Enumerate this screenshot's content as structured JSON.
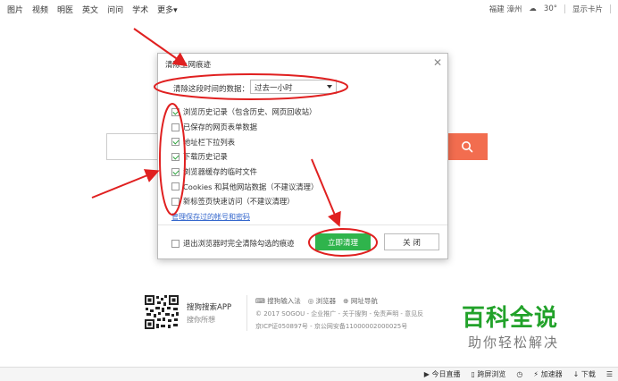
{
  "topnav": {
    "links": [
      "图片",
      "视频",
      "明医",
      "英文",
      "问问",
      "学术",
      "更多▾"
    ],
    "weather": "福建 漳州",
    "temperature": "30°",
    "show_card": "显示卡片"
  },
  "dialog": {
    "title": "清除上网痕迹",
    "time_label": "清除这段时间的数据：",
    "time_value": "过去一小时",
    "options": [
      {
        "label": "浏览历史记录（包含历史、网页回收站）",
        "checked": true
      },
      {
        "label": "已保存的网页表单数据",
        "checked": false
      },
      {
        "label": "地址栏下拉列表",
        "checked": true
      },
      {
        "label": "下载历史记录",
        "checked": true
      },
      {
        "label": "浏览器缓存的临时文件",
        "checked": true
      },
      {
        "label": "Cookies 和其他网站数据（不建议清理）",
        "checked": false
      },
      {
        "label": "新标签页快速访问（不建议清理）",
        "checked": false
      }
    ],
    "manage_link": "管理保存过的帐号和密码",
    "exit_clear_label": "退出浏览器时完全清除勾选的痕迹",
    "clear_button": "立即清理",
    "close_button": "关 闭"
  },
  "footer": {
    "app_title": "搜狗搜索APP",
    "app_sub": "搜你所想",
    "links": [
      "搜狗输入法",
      "浏览器",
      "网址导航"
    ],
    "copyright": "© 2017 SOGOU - 企业推广 - 关于搜狗 - 免责声明 - 意见反",
    "icp": "京ICP证050897号 - 京公网安备11000002000025号"
  },
  "watermark": {
    "title": "百科全说",
    "subtitle": "助你轻松解决"
  },
  "statusbar": {
    "items": [
      "今日直播",
      "跨屏浏览",
      "加速器",
      "下载"
    ]
  },
  "colors": {
    "accent_green": "#2fb44c",
    "search_orange": "#f26d4f",
    "annotation_red": "#e02020"
  }
}
